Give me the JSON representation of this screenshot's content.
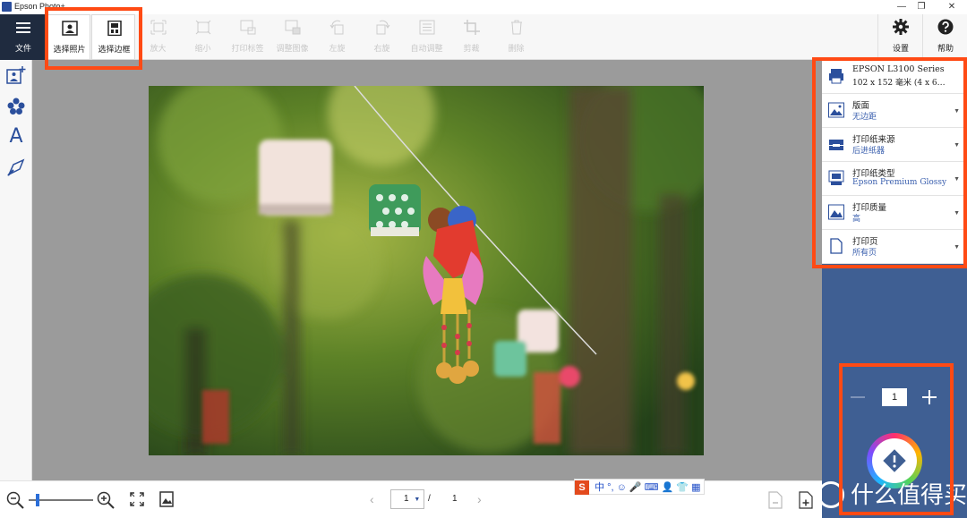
{
  "window": {
    "title": "Epson Photo+",
    "restore_glyph": "❐",
    "close_glyph": "✕"
  },
  "toolbar": {
    "menu_label": "文件",
    "tools": [
      {
        "label": "选择照片",
        "enabled": true,
        "icon": "photo-select-icon"
      },
      {
        "label": "选择边框",
        "enabled": true,
        "icon": "frame-select-icon"
      },
      {
        "label": "放大",
        "enabled": false,
        "icon": "zoom-in-frame-icon"
      },
      {
        "label": "缩小",
        "enabled": false,
        "icon": "zoom-out-frame-icon"
      },
      {
        "label": "打印标签",
        "enabled": false,
        "icon": "label-icon"
      },
      {
        "label": "调整图像",
        "enabled": false,
        "icon": "adjust-image-icon"
      },
      {
        "label": "左旋",
        "enabled": false,
        "icon": "rotate-left-icon"
      },
      {
        "label": "右旋",
        "enabled": false,
        "icon": "rotate-right-icon"
      },
      {
        "label": "自动调整",
        "enabled": false,
        "icon": "auto-adjust-icon"
      },
      {
        "label": "剪裁",
        "enabled": false,
        "icon": "crop-icon"
      },
      {
        "label": "删除",
        "enabled": false,
        "icon": "trash-icon"
      }
    ],
    "settings_label": "设置",
    "help_label": "帮助"
  },
  "left_bar": [
    "add-photo-icon",
    "stamp-icon",
    "text-icon",
    "tools-icon"
  ],
  "left_text_glyph": "A",
  "print_settings": [
    {
      "title": "EPSON L3100 Series",
      "value": "102 x 152 毫米 (4 x 6…",
      "icon": "printer-icon"
    },
    {
      "title": "版面",
      "value": "无边距",
      "icon": "layout-icon"
    },
    {
      "title": "打印纸来源",
      "value": "后进纸器",
      "icon": "paper-source-icon"
    },
    {
      "title": "打印纸类型",
      "value": "Epson Premium Glossy",
      "icon": "paper-type-icon"
    },
    {
      "title": "打印质量",
      "value": "高",
      "icon": "quality-icon"
    },
    {
      "title": "打印页",
      "value": "所有页",
      "icon": "pages-icon"
    }
  ],
  "copies": {
    "value": "1"
  },
  "pagination": {
    "current": "1",
    "separator": "/",
    "total": "1"
  },
  "ime_bar": {
    "label": "中 °, ☺ 🎤 ⌨ 👤 👕 ▦",
    "brand": "S"
  },
  "watermark": "什么值得买",
  "colors": {
    "accent": "#3f5f93",
    "highlight": "#ff4a14",
    "menu_bg": "#1f2b3f",
    "link": "#3a5fae"
  }
}
